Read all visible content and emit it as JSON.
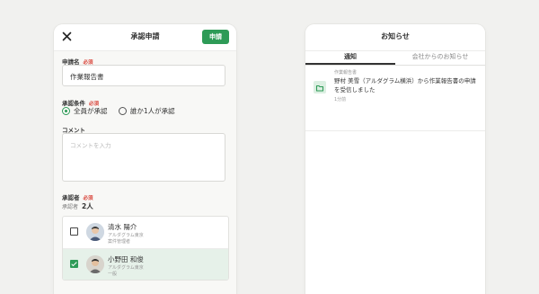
{
  "left_screen": {
    "header": {
      "title": "承認申請",
      "submit_label": "申請"
    },
    "request_name": {
      "label": "申請名",
      "required": "必須",
      "value": "作業報告書"
    },
    "approval_condition": {
      "label": "承認条件",
      "required": "必須",
      "options": [
        {
          "label": "全員が承認",
          "selected": true
        },
        {
          "label": "誰か1人が承認",
          "selected": false
        }
      ]
    },
    "comment": {
      "label": "コメント",
      "placeholder": "コメントを入力"
    },
    "approvers": {
      "label": "承認者",
      "required": "必須",
      "count_label": "承認者",
      "count_value": "2人",
      "people": [
        {
          "name": "清水 陽介",
          "company": "アルダグラム東京",
          "role": "案件管理者",
          "checked": false
        },
        {
          "name": "小野田 和俊",
          "company": "アルダグラム東京",
          "role": "一般",
          "checked": true
        }
      ]
    }
  },
  "right_screen": {
    "header": {
      "title": "お知らせ"
    },
    "tabs": [
      {
        "label": "通知",
        "active": true
      },
      {
        "label": "会社からのお知らせ",
        "active": false
      }
    ],
    "notification": {
      "category": "作業報告書",
      "message": "野村 美雪（アルダグラム横浜）から作業報告書の申請を受信しました",
      "time": "1分前",
      "icon": "folder-icon"
    }
  },
  "colors": {
    "accent": "#2e9b57",
    "required": "#d9463c",
    "selected_row": "#e6f1e9",
    "background": "#f1f1ef"
  }
}
